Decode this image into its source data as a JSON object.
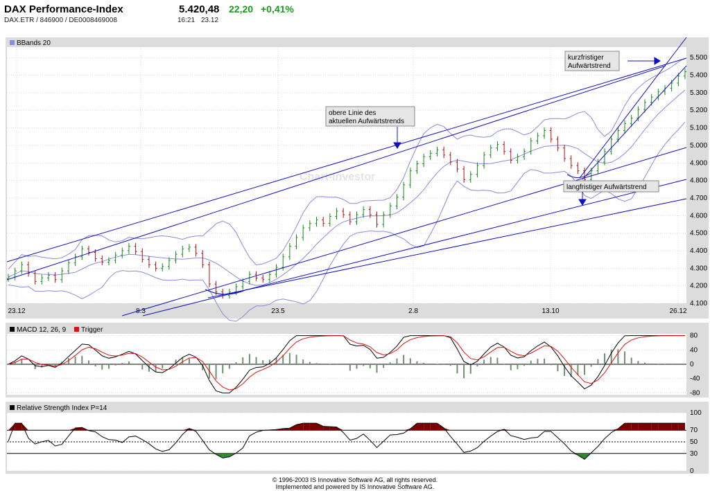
{
  "header": {
    "title": "DAX Performance-Index",
    "subline": "DAX.ETR  /  846900  /  DE0008469008",
    "last": "5.420,48",
    "change": "22,20",
    "change_pct": "+0,41%",
    "time": "16:21",
    "date": "23.12"
  },
  "colors": {
    "panel_bg": "#dcdcdc",
    "plot_bg": "#ffffff",
    "trendline": "#1010c0",
    "band": "#8a8ae0",
    "candle_up": "#128a12",
    "candle_down": "#b01010",
    "macd": "#000000",
    "trigger": "#e01010",
    "hist": "#6f8f6f",
    "rsi_over": "#7a0000",
    "rsi_under": "#2a8a2a"
  },
  "chart_data": [
    {
      "type": "candlestick",
      "legend": "BBands 20",
      "x_labels": [
        "23.12",
        "8.3",
        "23.5",
        "2.8",
        "13.10",
        "26.12"
      ],
      "y_ticks": [
        "5.500",
        "5.400",
        "5.300",
        "5.200",
        "5.100",
        "5.000",
        "4.900",
        "4.800",
        "4.700",
        "4.600",
        "4.500",
        "4.400",
        "4.300",
        "4.200",
        "4.100"
      ],
      "ylim": [
        4100,
        5560
      ],
      "watermark": "Chart-Investor",
      "close": [
        4250,
        4285,
        4320,
        4270,
        4225,
        4245,
        4260,
        4235,
        4285,
        4330,
        4365,
        4410,
        4390,
        4355,
        4335,
        4345,
        4375,
        4400,
        4425,
        4395,
        4350,
        4320,
        4300,
        4310,
        4345,
        4380,
        4410,
        4420,
        4385,
        4320,
        4210,
        4165,
        4145,
        4165,
        4195,
        4225,
        4265,
        4245,
        4235,
        4265,
        4305,
        4365,
        4425,
        4475,
        4530,
        4555,
        4575,
        4555,
        4595,
        4625,
        4605,
        4565,
        4605,
        4635,
        4605,
        4550,
        4605,
        4655,
        4705,
        4775,
        4855,
        4895,
        4935,
        4955,
        4975,
        4945,
        4905,
        4865,
        4805,
        4835,
        4885,
        4945,
        4985,
        5005,
        4965,
        4915,
        4935,
        4965,
        5025,
        5055,
        5085,
        5035,
        4985,
        4925,
        4885,
        4855,
        4805,
        4855,
        4905,
        4965,
        5035,
        5085,
        5125,
        5155,
        5205,
        5245,
        5275,
        5305,
        5325,
        5355,
        5395,
        5420
      ],
      "annotations": [
        {
          "text": [
            "obere Linie des",
            "aktuellen Aufwärtstrends"
          ]
        },
        {
          "text": [
            "kurzfristiger",
            "Aufwärtstrend"
          ]
        },
        {
          "text": [
            "langfristiger Aufwärtstrend"
          ]
        }
      ]
    },
    {
      "type": "line",
      "legend": [
        "MACD 12, 26, 9",
        "Trigger"
      ],
      "y_ticks": [
        "80",
        "40",
        "0",
        "-40",
        "-80"
      ],
      "ylim": [
        -85,
        85
      ]
    },
    {
      "type": "area",
      "legend": "Relative Strength Index P=14",
      "y_ticks": [
        "100",
        "70",
        "50",
        "30",
        "0"
      ],
      "ylim": [
        0,
        100
      ],
      "levels": [
        70,
        50,
        30
      ]
    }
  ],
  "footer": {
    "line1": "© 1996-2003 IS Innovative Software AG, all rights reserved.",
    "line2": "Implemented and powered by IS Innovative Software AG."
  }
}
